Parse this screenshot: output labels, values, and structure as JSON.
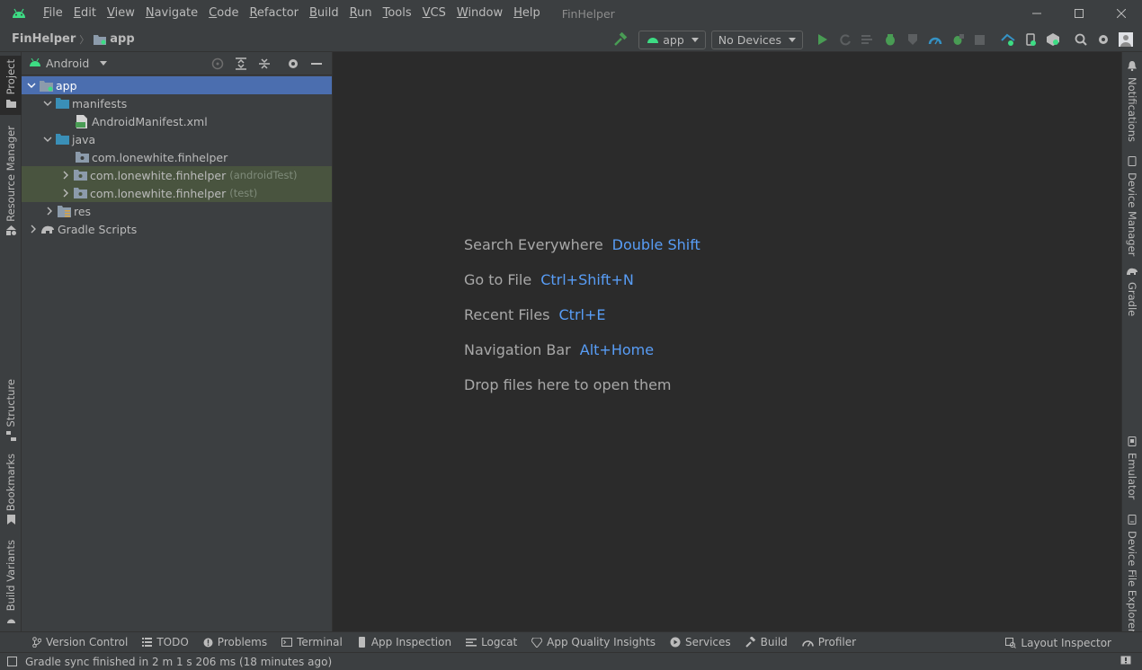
{
  "window": {
    "title": "FinHelper",
    "menu": [
      {
        "mnemonic": "F",
        "rest": "ile"
      },
      {
        "mnemonic": "E",
        "rest": "dit"
      },
      {
        "mnemonic": "V",
        "rest": "iew"
      },
      {
        "mnemonic": "N",
        "rest": "avigate"
      },
      {
        "mnemonic": "C",
        "rest": "ode"
      },
      {
        "mnemonic": "R",
        "rest": "efactor"
      },
      {
        "mnemonic": "B",
        "rest": "uild"
      },
      {
        "mnemonic": "R",
        "rest": "un"
      },
      {
        "mnemonic": "T",
        "rest": "ools"
      },
      {
        "mnemonic": "V",
        "rest": "CS"
      },
      {
        "mnemonic": "W",
        "rest": "indow"
      },
      {
        "mnemonic": "H",
        "rest": "elp"
      }
    ]
  },
  "breadcrumb": {
    "project": "FinHelper",
    "module": "app"
  },
  "toolbar": {
    "run_config": "app",
    "device": "No Devices"
  },
  "project_panel": {
    "view_mode": "Android"
  },
  "tree": [
    {
      "label": "app",
      "hint": "",
      "depth": 0,
      "expanded": true,
      "icon": "module-folder-icon"
    },
    {
      "label": "manifests",
      "hint": "",
      "depth": 1,
      "expanded": true,
      "icon": "folder-icon"
    },
    {
      "label": "AndroidManifest.xml",
      "hint": "",
      "depth": 2,
      "expanded": null,
      "icon": "manifest-file-icon"
    },
    {
      "label": "java",
      "hint": "",
      "depth": 1,
      "expanded": true,
      "icon": "folder-icon"
    },
    {
      "label": "com.lonewhite.finhelper",
      "hint": "",
      "depth": 2,
      "expanded": null,
      "icon": "package-icon"
    },
    {
      "label": "com.lonewhite.finhelper",
      "hint": "(androidTest)",
      "depth": 2,
      "expanded": false,
      "icon": "package-icon"
    },
    {
      "label": "com.lonewhite.finhelper",
      "hint": "(test)",
      "depth": 2,
      "expanded": false,
      "icon": "package-icon"
    },
    {
      "label": "res",
      "hint": "",
      "depth": 1,
      "expanded": false,
      "icon": "res-folder-icon"
    },
    {
      "label": "Gradle Scripts",
      "hint": "",
      "depth": 0,
      "expanded": false,
      "icon": "gradle-icon"
    }
  ],
  "editor_hints": [
    {
      "text": "Search Everywhere",
      "key": "Double Shift"
    },
    {
      "text": "Go to File",
      "key": "Ctrl+Shift+N"
    },
    {
      "text": "Recent Files",
      "key": "Ctrl+E"
    },
    {
      "text": "Navigation Bar",
      "key": "Alt+Home"
    },
    {
      "text": "Drop files here to open them",
      "key": ""
    }
  ],
  "left_tabs": {
    "project": "Project",
    "resource_manager": "Resource Manager",
    "structure": "Structure",
    "bookmarks": "Bookmarks",
    "build_variants": "Build Variants"
  },
  "right_tabs": {
    "notifications": "Notifications",
    "device_manager": "Device Manager",
    "gradle": "Gradle",
    "emulator": "Emulator",
    "device_file_explorer": "Device File Explorer"
  },
  "bottom_tabs": {
    "version_control": "Version Control",
    "todo": "TODO",
    "problems": "Problems",
    "terminal": "Terminal",
    "app_inspection": "App Inspection",
    "logcat": "Logcat",
    "app_quality": "App Quality Insights",
    "services": "Services",
    "build": "Build",
    "profiler": "Profiler",
    "layout_inspector": "Layout Inspector"
  },
  "status": {
    "message": "Gradle sync finished in 2 m 1 s 206 ms (18 minutes ago)"
  },
  "colors": {
    "accent": "#4b6eaf",
    "link": "#589df6",
    "run_green": "#499c54",
    "android_green": "#3ddc84"
  }
}
